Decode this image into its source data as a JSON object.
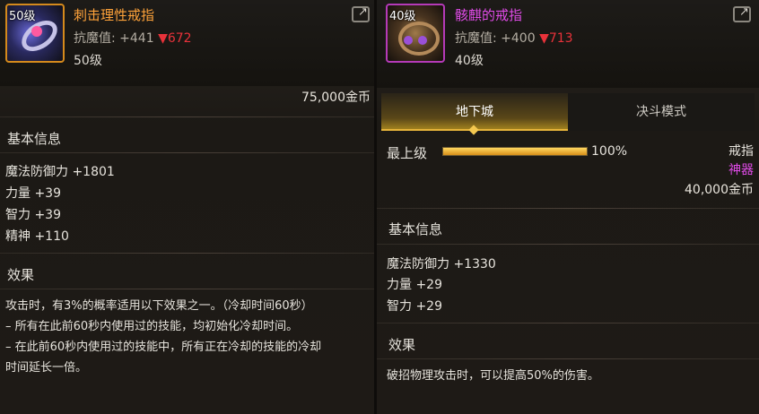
{
  "left": {
    "level_badge": "50级",
    "item_name": "刺击理性戒指",
    "stat_label": "抗魔值:",
    "stat_base": "+441",
    "stat_arrow": "▼",
    "stat_new": "672",
    "level_text": "50级",
    "price": "75,000金币",
    "basic_info_title": "基本信息",
    "attributes": [
      "魔法防御力 +1801",
      "力量 +39",
      "智力 +39",
      "精神 +110"
    ],
    "effect_title": "效果",
    "effect_lines": [
      "攻击时，有3%的概率适用以下效果之一。（冷却时间60秒）",
      "– 所有在此前60秒内使用过的技能，均初始化冷却时间。",
      "– 在此前60秒内使用过的技能中，所有正在冷却的技能的冷却",
      "时间延长一倍。"
    ]
  },
  "right": {
    "level_badge": "40级",
    "item_name": "骸麒的戒指",
    "stat_label": "抗魔值:",
    "stat_base": "+400",
    "stat_arrow": "▼",
    "stat_new": "713",
    "level_text": "40级",
    "tabs": [
      "地下城",
      "决斗模式"
    ],
    "upgrade_label": "最上级",
    "upgrade_percent": "100%",
    "upgrade_progress": 1.0,
    "item_type": "戒指",
    "item_grade": "神器",
    "price": "40,000金币",
    "basic_info_title": "基本信息",
    "attributes": [
      "魔法防御力 +1330",
      "力量 +29",
      "智力 +29"
    ],
    "effect_title": "效果",
    "effect_lines": [
      "破招物理攻击时，可以提高50%的伤害。"
    ]
  },
  "colors": {
    "epic_name": "#ffa33a",
    "artifact_name": "#e04be8",
    "stat_decrease": "#e8323a",
    "tab_highlight": "#e7b43a"
  },
  "icons": {
    "left_item": "ring-icon",
    "right_item": "ring-icon",
    "share": "share-icon"
  }
}
